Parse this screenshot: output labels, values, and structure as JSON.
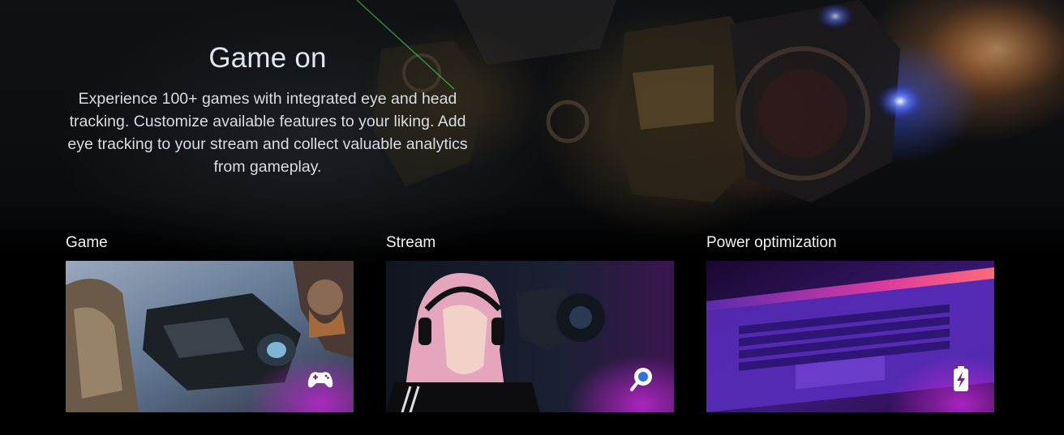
{
  "hero": {
    "title": "Game on",
    "description": "Experience 100+ games with integrated eye and head tracking. Customize available features to your liking. Add eye tracking to your stream and collect valuable analytics from gameplay."
  },
  "features": [
    {
      "label": "Game",
      "icon": "gamepad-icon"
    },
    {
      "label": "Stream",
      "icon": "stream-icon"
    },
    {
      "label": "Power optimization",
      "icon": "battery-icon"
    }
  ],
  "colors": {
    "background": "#000000",
    "accent": "#b12fd6",
    "text": "#e6e6e6"
  }
}
